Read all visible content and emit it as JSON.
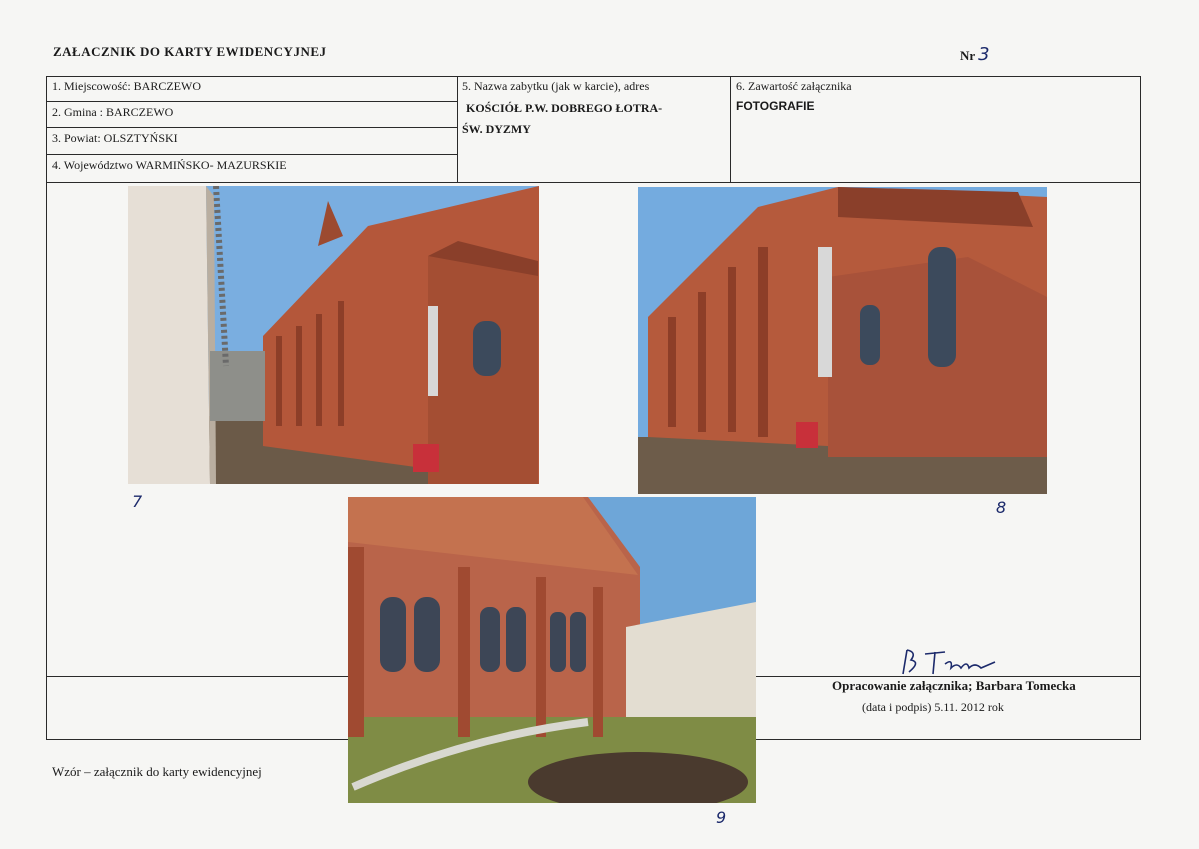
{
  "header": {
    "title": "ZAŁACZNIK DO KARTY EWIDENCYJNEJ",
    "nr_label": "Nr",
    "nr_value": "3"
  },
  "form": {
    "field1": "1. Miejscowość: BARCZEWO",
    "field2": "2. Gmina : BARCZEWO",
    "field3": "3. Powiat: OLSZTYŃSKI",
    "field4": "4. Województwo WARMIŃSKO- MAZURSKIE",
    "field5_label": "5. Nazwa zabytku (jak w karcie), adres",
    "field5_value_line1": "KOŚCIÓŁ P.W. DOBREGO ŁOTRA-",
    "field5_value_line2": "ŚW. DYZMY",
    "field6_label": "6. Zawartość załącznika",
    "field6_value": "FOTOGRAFIE"
  },
  "photos": [
    {
      "number": "7",
      "icon": "church-photo"
    },
    {
      "number": "8",
      "icon": "church-photo"
    },
    {
      "number": "9",
      "icon": "church-photo"
    }
  ],
  "signature_block": {
    "author": "Opracowanie załącznika; Barbara Tomecka",
    "date": "(data i podpis) 5.11. 2012 rok"
  },
  "footer": {
    "text": "Wzór – załącznik do karty ewidencyjnej"
  },
  "colors": {
    "brick": "#b4573a",
    "sky": "#6ea6d8",
    "ink": "#1c2a6b"
  }
}
